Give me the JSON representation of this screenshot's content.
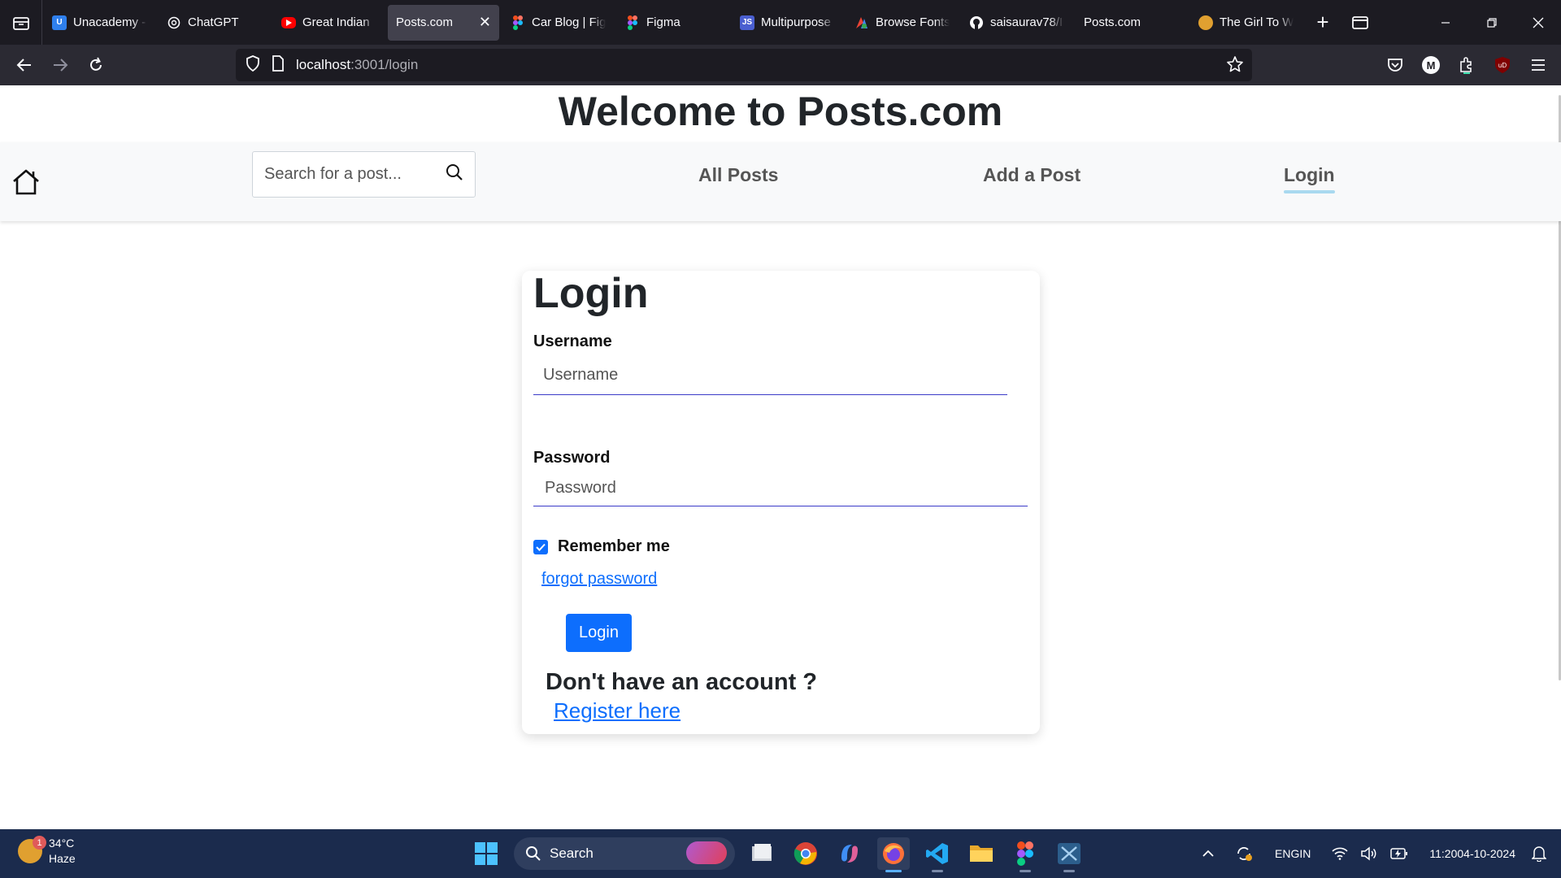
{
  "browser": {
    "tabs": [
      {
        "title": "Unacademy -",
        "favicon": "unacademy-icon",
        "color": "#2f80ed",
        "active": false
      },
      {
        "title": "ChatGPT",
        "favicon": "chatgpt-icon",
        "color": "#2b2a33",
        "active": false
      },
      {
        "title": "Great Indian",
        "favicon": "youtube-icon",
        "color": "#ff0000",
        "active": false
      },
      {
        "title": "Posts.com",
        "favicon": "",
        "color": "",
        "active": true
      },
      {
        "title": "Car Blog | Fig",
        "favicon": "figma-icon",
        "color": "#a259ff",
        "active": false
      },
      {
        "title": "Figma",
        "favicon": "figma-icon",
        "color": "#a259ff",
        "active": false
      },
      {
        "title": "Multipurpose",
        "favicon": "js-icon",
        "color": "#4a5fd0",
        "active": false
      },
      {
        "title": "Browse Fonts",
        "favicon": "google-fonts-icon",
        "color": "#e24f3a",
        "active": false
      },
      {
        "title": "saisaurav78/I",
        "favicon": "github-icon",
        "color": "#fbfbfe",
        "active": false
      },
      {
        "title": "Posts.com",
        "favicon": "",
        "color": "",
        "active": false
      },
      {
        "title": "The Girl To W",
        "favicon": "website-icon",
        "color": "#e0a030",
        "active": false
      }
    ],
    "url": {
      "host": "localhost",
      "rest": ":3001/login"
    }
  },
  "site": {
    "title": "Welcome to Posts.com",
    "search_placeholder": "Search for a post...",
    "nav": {
      "all_posts": "All Posts",
      "add_post": "Add a Post",
      "login": "Login"
    }
  },
  "login_card": {
    "heading": "Login",
    "username_label": "Username",
    "username_placeholder": "Username",
    "password_label": "Password",
    "password_placeholder": "Password",
    "remember_label": "Remember me",
    "remember_checked": true,
    "forgot_link": "forgot password",
    "submit_label": "Login",
    "no_account_text": "Don't have an account ?",
    "register_link": "Register here"
  },
  "taskbar": {
    "weather": {
      "temp": "34°C",
      "condition": "Haze",
      "badge": "1"
    },
    "search_label": "Search",
    "apps": [
      "file-manager-icon",
      "chrome-icon",
      "copilot-icon",
      "firefox-icon",
      "vscode-icon",
      "file-explorer-icon",
      "figma-icon",
      "xampp-icon"
    ],
    "lang": {
      "line1": "ENG",
      "line2": "IN"
    },
    "clock": {
      "time": "11:20",
      "date": "04-10-2024"
    }
  },
  "colors": {
    "accent": "#0d6efd",
    "nav_underline": "#a9d9ef",
    "input_underline": "#3b3bc8"
  }
}
